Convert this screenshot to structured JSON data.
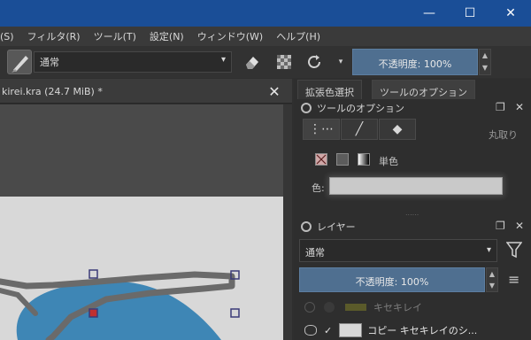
{
  "window": {
    "minimize_glyph": "—",
    "maximize_glyph": "☐",
    "close_glyph": "✕"
  },
  "menu": [
    "(S)",
    "フィルタ(R)",
    "ツール(T)",
    "設定(N)",
    "ウィンドウ(W)",
    "ヘルプ(H)"
  ],
  "toolbar": {
    "blend_mode": "通常",
    "opacity_label": "不透明度: 100%",
    "dropdown_glyph": "▾"
  },
  "document": {
    "tab_title": "kirei.kra (24.7 MiB) *",
    "close_glyph": "✕"
  },
  "dockers": {
    "tabs": [
      "拡張色選択",
      "ツールのオプション"
    ],
    "tool_options_title": "ツールのオプション",
    "tool_option_tabs": [
      "⋮⋯",
      "╱",
      "◆"
    ],
    "side_label": "丸取り",
    "fill_mode_label": "単色",
    "color_label": "色:",
    "separator": "......"
  },
  "layers": {
    "title": "レイヤー",
    "blend_mode": "通常",
    "opacity_label": "不透明度: 100%",
    "items": [
      {
        "name": "キセキレイ"
      },
      {
        "name": "コピー キセキレイのシ..."
      }
    ]
  },
  "colors": {
    "titlebar": "#1a4e97",
    "accent_blue": "#4f6f90",
    "canvas_blue": "#3e86b5",
    "node_red": "#c03030"
  }
}
